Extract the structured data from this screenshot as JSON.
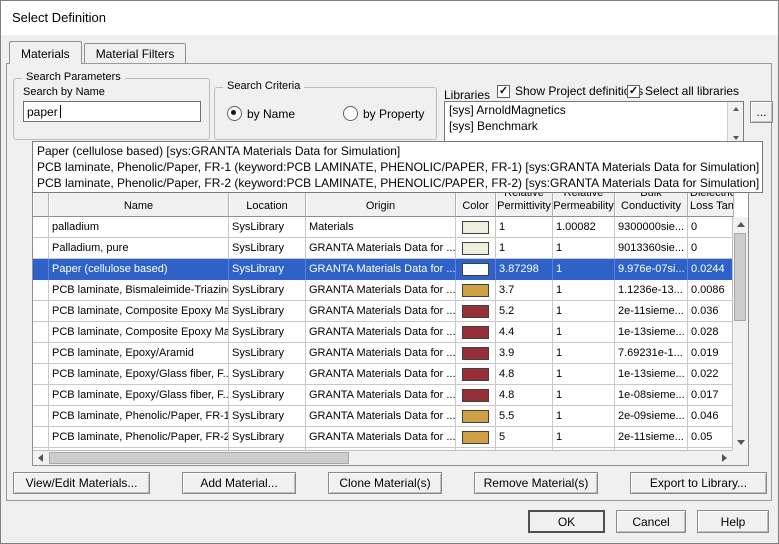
{
  "window": {
    "title": "Select Definition"
  },
  "tabs": {
    "materials": "Materials",
    "material_filters": "Material Filters"
  },
  "search_parameters": {
    "group_label": "Search Parameters",
    "field_label": "Search by Name",
    "value": "paper"
  },
  "search_criteria": {
    "group_label": "Search Criteria",
    "by_name": "by Name",
    "by_property": "by Property"
  },
  "libraries": {
    "label": "Libraries",
    "show_project_definitions": "Show Project definitions",
    "select_all_libraries": "Select all libraries",
    "items": [
      "[sys] ArnoldMagnetics",
      "[sys] Benchmark"
    ],
    "browse": "..."
  },
  "suggestions": [
    "Paper (cellulose based) [sys:GRANTA Materials Data for Simulation]",
    "PCB laminate, Phenolic/Paper, FR-1 (keyword:PCB LAMINATE, PHENOLIC/PAPER, FR-1) [sys:GRANTA Materials Data for Simulation]",
    "PCB laminate, Phenolic/Paper, FR-2 (keyword:PCB LAMINATE, PHENOLIC/PAPER, FR-2) [sys:GRANTA Materials Data for Simulation]"
  ],
  "table": {
    "columns": [
      "",
      "Name",
      "Location",
      "Origin",
      "Color",
      "Relative\nPermittivity",
      "Relative\nPermeability",
      "Bulk\nConductivity",
      "Dielectric\nLoss Tangent"
    ],
    "rows": [
      {
        "name": "palladium",
        "location": "SysLibrary",
        "origin": "Materials",
        "color": "#f0eedd",
        "permittivity": "1",
        "permeability": "1.00082",
        "conductivity": "9300000sie...",
        "loss": "0",
        "selected": false
      },
      {
        "name": "Palladium, pure",
        "location": "SysLibrary",
        "origin": "GRANTA Materials Data for ...",
        "color": "#f0eedd",
        "permittivity": "1",
        "permeability": "1",
        "conductivity": "9013360sie...",
        "loss": "0",
        "selected": false
      },
      {
        "name": "Paper (cellulose based)",
        "location": "SysLibrary",
        "origin": "GRANTA Materials Data for ...",
        "color": "#ffffff",
        "permittivity": "3.87298",
        "permeability": "1",
        "conductivity": "9.976e-07si...",
        "loss": "0.0244",
        "selected": true
      },
      {
        "name": "PCB laminate, Bismaleimide-Triazine",
        "location": "SysLibrary",
        "origin": "GRANTA Materials Data for ...",
        "color": "#cfa144",
        "permittivity": "3.7",
        "permeability": "1",
        "conductivity": "1.1236e-13...",
        "loss": "0.0086",
        "selected": false
      },
      {
        "name": "PCB laminate, Composite Epoxy Ma...",
        "location": "SysLibrary",
        "origin": "GRANTA Materials Data for ...",
        "color": "#972f39",
        "permittivity": "5.2",
        "permeability": "1",
        "conductivity": "2e-11sieme...",
        "loss": "0.036",
        "selected": false
      },
      {
        "name": "PCB laminate, Composite Epoxy Ma...",
        "location": "SysLibrary",
        "origin": "GRANTA Materials Data for ...",
        "color": "#972f39",
        "permittivity": "4.4",
        "permeability": "1",
        "conductivity": "1e-13sieme...",
        "loss": "0.028",
        "selected": false
      },
      {
        "name": "PCB laminate, Epoxy/Aramid",
        "location": "SysLibrary",
        "origin": "GRANTA Materials Data for ...",
        "color": "#972f39",
        "permittivity": "3.9",
        "permeability": "1",
        "conductivity": "7.69231e-1...",
        "loss": "0.019",
        "selected": false
      },
      {
        "name": "PCB laminate, Epoxy/Glass fiber, F...",
        "location": "SysLibrary",
        "origin": "GRANTA Materials Data for ...",
        "color": "#972f39",
        "permittivity": "4.8",
        "permeability": "1",
        "conductivity": "1e-13sieme...",
        "loss": "0.022",
        "selected": false
      },
      {
        "name": "PCB laminate, Epoxy/Glass fiber, F...",
        "location": "SysLibrary",
        "origin": "GRANTA Materials Data for ...",
        "color": "#972f39",
        "permittivity": "4.8",
        "permeability": "1",
        "conductivity": "1e-08sieme...",
        "loss": "0.017",
        "selected": false
      },
      {
        "name": "PCB laminate, Phenolic/Paper, FR-1",
        "location": "SysLibrary",
        "origin": "GRANTA Materials Data for ...",
        "color": "#cfa144",
        "permittivity": "5.5",
        "permeability": "1",
        "conductivity": "2e-09sieme...",
        "loss": "0.046",
        "selected": false
      },
      {
        "name": "PCB laminate, Phenolic/Paper, FR-2",
        "location": "SysLibrary",
        "origin": "GRANTA Materials Data for ...",
        "color": "#cfa144",
        "permittivity": "5",
        "permeability": "1",
        "conductivity": "2e-11sieme...",
        "loss": "0.05",
        "selected": false
      },
      {
        "name": "",
        "location": "",
        "origin": "",
        "color": "",
        "permittivity": "",
        "permeability": "",
        "conductivity": "",
        "loss": "",
        "selected": false
      }
    ]
  },
  "actions": [
    "View/Edit Materials...",
    "Add Material...",
    "Clone Material(s)",
    "Remove Material(s)",
    "Export to Library..."
  ],
  "footer": {
    "ok": "OK",
    "cancel": "Cancel",
    "help": "Help"
  },
  "colors": {
    "selection": "#2e62c9",
    "swatch_cream": "#f0eedd",
    "swatch_tan": "#cfa144",
    "swatch_red": "#972f39",
    "swatch_white": "#ffffff"
  }
}
